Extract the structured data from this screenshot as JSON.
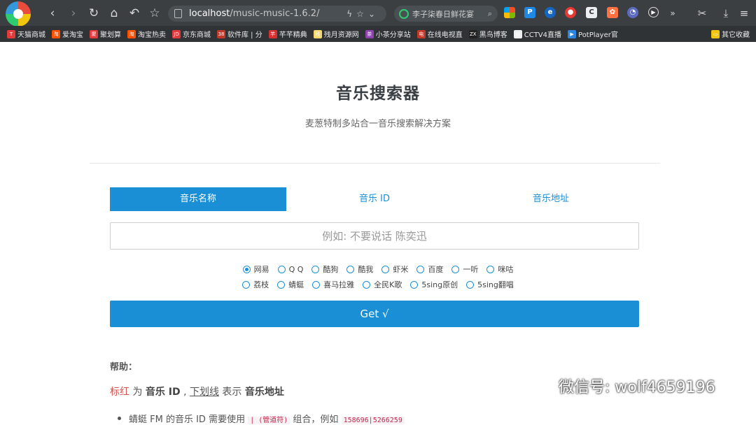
{
  "browser": {
    "url_host": "localhost",
    "url_path": "/music-music-1.6.2/",
    "search_query": "李子柒春日鲜花宴",
    "bookmarks": [
      {
        "label": "天猫商城",
        "color": "#e43a3a",
        "text": "T"
      },
      {
        "label": "爱淘宝",
        "color": "#ff5000",
        "text": "淘"
      },
      {
        "label": "聚划算",
        "color": "#e4393c",
        "text": "聚"
      },
      {
        "label": "淘宝热卖",
        "color": "#ff5000",
        "text": "淘"
      },
      {
        "label": "京东商城",
        "color": "#e4393c",
        "text": "JD"
      },
      {
        "label": "软件库 | 分",
        "color": "#c0392b",
        "text": "38"
      },
      {
        "label": "芊芊精典",
        "color": "#d63031",
        "text": "芊"
      },
      {
        "label": "残月资源网",
        "color": "#f5d76e",
        "text": "残"
      },
      {
        "label": "小茶分享站",
        "color": "#8e44ad",
        "text": "茶"
      },
      {
        "label": "在线电视直",
        "color": "#c0392b",
        "text": "电"
      },
      {
        "label": "黑鸟博客",
        "color": "#222",
        "text": "ZX"
      },
      {
        "label": "CCTV4直播",
        "color": "#ecf0f1",
        "text": "▤"
      },
      {
        "label": "PotPlayer官",
        "color": "#2e86de",
        "text": "▶"
      },
      {
        "label": "其它收藏",
        "color": "#f1c40f",
        "text": "▭"
      }
    ]
  },
  "page": {
    "title": "音乐搜索器",
    "subtitle": "麦葱特制多站合一音乐搜索解决方案"
  },
  "tabs": [
    {
      "label": "音乐名称",
      "active": true
    },
    {
      "label": "音乐 ID",
      "active": false
    },
    {
      "label": "音乐地址",
      "active": false
    }
  ],
  "search": {
    "placeholder": "例如: 不要说话 陈奕迅",
    "value": ""
  },
  "sources_row1": [
    {
      "label": "网易",
      "selected": true
    },
    {
      "label": "Q Q",
      "selected": false
    },
    {
      "label": "酷狗",
      "selected": false
    },
    {
      "label": "酷我",
      "selected": false
    },
    {
      "label": "虾米",
      "selected": false
    },
    {
      "label": "百度",
      "selected": false
    },
    {
      "label": "一听",
      "selected": false
    },
    {
      "label": "咪咕",
      "selected": false
    }
  ],
  "sources_row2": [
    {
      "label": "荔枝",
      "selected": false
    },
    {
      "label": "蜻蜓",
      "selected": false
    },
    {
      "label": "喜马拉雅",
      "selected": false
    },
    {
      "label": "全民K歌",
      "selected": false
    },
    {
      "label": "5sing原创",
      "selected": false
    },
    {
      "label": "5sing翻唱",
      "selected": false
    }
  ],
  "get_button": "Get √",
  "help": {
    "title": "帮助：",
    "red_label": "标红",
    "t1": " 为 ",
    "b1": "音乐 ID",
    "t2": " , ",
    "underline_label": "下划线",
    "t3": " 表示 ",
    "b2": "音乐地址",
    "bullet_text": "蜻蜓 FM 的音乐 ID 需要使用 ",
    "bullet_code1": "| (管道符)",
    "bullet_text2": " 组合，例如 ",
    "bullet_code2": "158696|5266259"
  },
  "watermark": "微信号: wolf4659196"
}
